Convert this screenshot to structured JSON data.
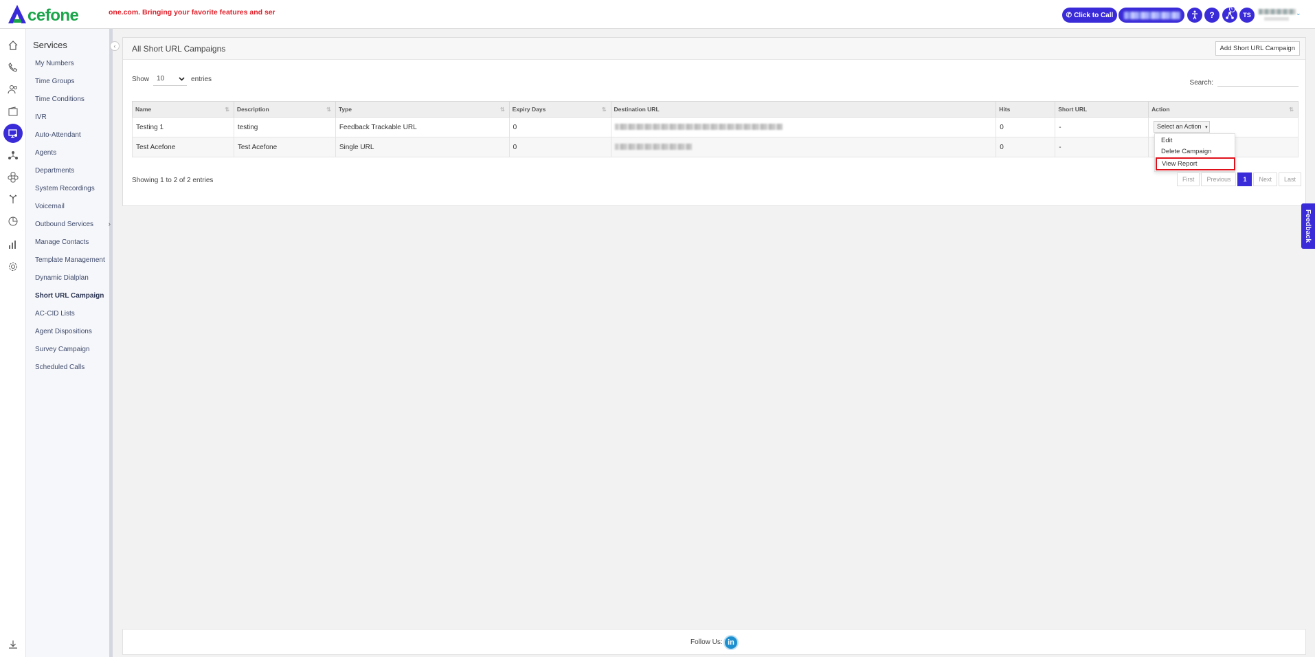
{
  "header": {
    "logo_text": "cefone",
    "marquee": "one.com. Bringing your favorite features and services wit",
    "click_to_call": "Click to Call",
    "help_symbol": "?",
    "user_initials": "TS",
    "notification_count": "0"
  },
  "services": {
    "title": "Services",
    "items": [
      {
        "label": "My Numbers"
      },
      {
        "label": "Time Groups"
      },
      {
        "label": "Time Conditions"
      },
      {
        "label": "IVR"
      },
      {
        "label": "Auto-Attendant"
      },
      {
        "label": "Agents"
      },
      {
        "label": "Departments"
      },
      {
        "label": "System Recordings"
      },
      {
        "label": "Voicemail"
      },
      {
        "label": "Outbound Services"
      },
      {
        "label": "Manage Contacts"
      },
      {
        "label": "Template Management"
      },
      {
        "label": "Dynamic Dialplan"
      },
      {
        "label": "Short URL Campaign"
      },
      {
        "label": "AC-CID Lists"
      },
      {
        "label": "Agent Dispositions"
      },
      {
        "label": "Survey Campaign"
      },
      {
        "label": "Scheduled Calls"
      }
    ]
  },
  "panel": {
    "title": "All Short URL Campaigns",
    "add_button": "Add Short URL Campaign",
    "show_label": "Show",
    "entries_value": "10",
    "entries_label": "entries",
    "search_label": "Search:",
    "search_value": ""
  },
  "table": {
    "columns": [
      "Name",
      "Description",
      "Type",
      "Expiry Days",
      "Destination URL",
      "Hits",
      "Short URL",
      "Action"
    ],
    "rows": [
      {
        "name": "Testing 1",
        "description": "testing",
        "type": "Feedback Trackable URL",
        "expiry_days": "0",
        "hits": "0",
        "short_url": "-"
      },
      {
        "name": "Test Acefone",
        "description": "Test Acefone",
        "type": "Single URL",
        "expiry_days": "0",
        "hits": "0",
        "short_url": "-"
      }
    ]
  },
  "action_menu": {
    "select_label": "Select an Action",
    "items": [
      "Edit",
      "Delete Campaign",
      "View Report"
    ]
  },
  "pagination": {
    "info": "Showing 1 to 2 of 2 entries",
    "first": "First",
    "previous": "Previous",
    "current": "1",
    "next": "Next",
    "last": "Last"
  },
  "feedback_tab": "Feedback",
  "footer": {
    "follow_label": "Follow Us:",
    "linkedin": "in"
  },
  "colors": {
    "accent": "#3a2bd8",
    "brand_green": "#1aa54a",
    "marquee_red": "#e0202a",
    "highlight_red": "#e0101a"
  }
}
